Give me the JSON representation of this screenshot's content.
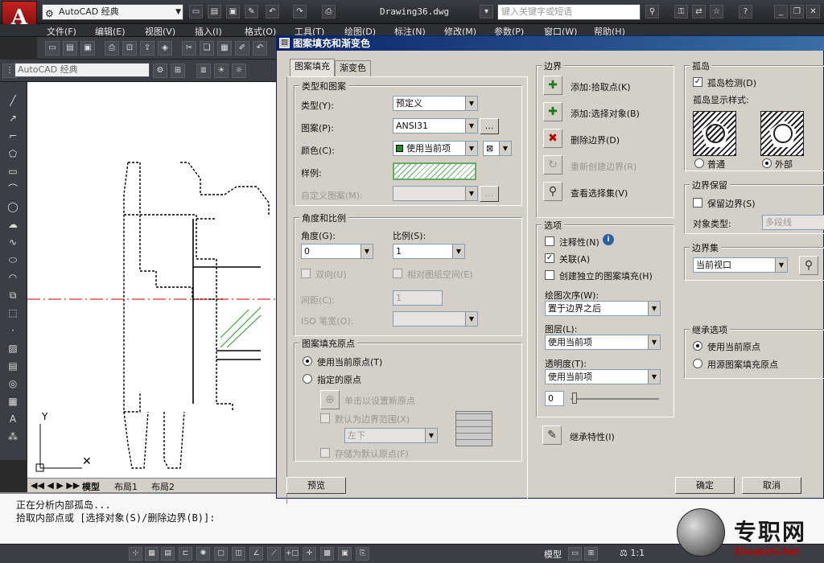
{
  "app": {
    "workspace": "AutoCAD 经典",
    "document": "Drawing36.dwg",
    "search_placeholder": "键入关键字或短语"
  },
  "menus": [
    "文件(F)",
    "编辑(E)",
    "视图(V)",
    "插入(I)",
    "格式(O)",
    "工具(T)",
    "绘图(D)",
    "标注(N)",
    "修改(M)",
    "参数(P)",
    "窗口(W)",
    "帮助(H)"
  ],
  "toolbar2_workspace": "AutoCAD 经典",
  "layout_tabs": [
    "模型",
    "布局1",
    "布局2"
  ],
  "command_lines": [
    "正在分析内部孤岛...",
    "拾取内部点或 [选择对象(S)/删除边界(B)]:"
  ],
  "status": {
    "model": "模型",
    "scale": "1:1"
  },
  "dialog": {
    "title": "图案填充和渐变色",
    "tabs": [
      "图案填充",
      "渐变色"
    ],
    "type_pattern": {
      "group": "类型和图案",
      "type_label": "类型(Y):",
      "type_value": "预定义",
      "pattern_label": "图案(P):",
      "pattern_value": "ANSI31",
      "pattern_btn": "...",
      "color_label": "颜色(C):",
      "color_value": "使用当前项",
      "sample_label": "样例:",
      "custom_label": "自定义图案(M):",
      "custom_btn": "..."
    },
    "angle_scale": {
      "group": "角度和比例",
      "angle_label": "角度(G):",
      "angle_value": "0",
      "scale_label": "比例(S):",
      "scale_value": "1",
      "double_label": "双向(U)",
      "relative_label": "相对图纸空间(E)",
      "spacing_label": "间距(C):",
      "spacing_value": "1",
      "iso_label": "ISO 笔宽(O):"
    },
    "origin": {
      "group": "图案填充原点",
      "use_current": "使用当前原点(T)",
      "specified": "指定的原点",
      "click_set": "单击以设置新原点",
      "default_extent": "默认为边界范围(X)",
      "extent_value": "左下",
      "store_default": "存储为默认原点(F)"
    },
    "boundary": {
      "group": "边界",
      "add_pick": "添加:拾取点(K)",
      "add_select": "添加:选择对象(B)",
      "remove": "删除边界(D)",
      "recreate": "重新创建边界(R)",
      "view_sel": "查看选择集(V)"
    },
    "options": {
      "group": "选项",
      "annotative": "注释性(N)",
      "associative": "关联(A)",
      "independent": "创建独立的图案填充(H)",
      "draw_order_label": "绘图次序(W):",
      "draw_order_value": "置于边界之后",
      "layer_label": "图层(L):",
      "layer_value": "使用当前项",
      "transp_label": "透明度(T):",
      "transp_value": "使用当前项",
      "transp_num": "0"
    },
    "inherit_btn": "继承特性(I)",
    "islands": {
      "group": "孤岛",
      "detect": "孤岛检测(D)",
      "style_label": "孤岛显示样式:",
      "normal": "普通",
      "outer": "外部"
    },
    "retain": {
      "group": "边界保留",
      "retain_label": "保留边界(S)",
      "obj_type_label": "对象类型:",
      "obj_type_value": "多段线"
    },
    "boundary_set": {
      "group": "边界集",
      "value": "当前视口"
    },
    "inherit_opts": {
      "group": "继承选项",
      "use_current": "使用当前原点",
      "use_source": "用源图案填充原点"
    },
    "buttons": {
      "preview": "预览",
      "ok": "确定",
      "cancel": "取消"
    }
  },
  "watermark": {
    "cn": "专职网",
    "en": "Zhuanzhi.Net"
  }
}
